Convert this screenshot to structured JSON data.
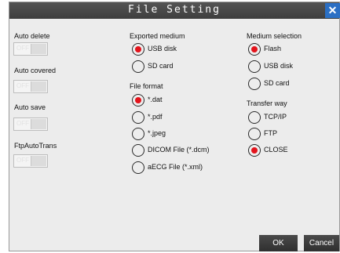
{
  "dialog": {
    "title": "File Setting",
    "close_label": "✕"
  },
  "left": {
    "items": [
      {
        "label": "Auto delete",
        "toggle": "OFF"
      },
      {
        "label": "Auto covered",
        "toggle": "OFF"
      },
      {
        "label": "Auto save",
        "toggle": "OFF"
      },
      {
        "label": "FtpAutoTrans",
        "toggle": "OFF"
      }
    ]
  },
  "exported_medium": {
    "label": "Exported medium",
    "options": [
      {
        "label": "USB disk",
        "selected": true
      },
      {
        "label": "SD card",
        "selected": false
      }
    ]
  },
  "file_format": {
    "label": "File format",
    "options": [
      {
        "label": "*.dat",
        "selected": true
      },
      {
        "label": "*.pdf",
        "selected": false
      },
      {
        "label": "*.jpeg",
        "selected": false
      },
      {
        "label": "DICOM File (*.dcm)",
        "selected": false
      },
      {
        "label": "aECG File (*.xml)",
        "selected": false
      }
    ]
  },
  "medium_selection": {
    "label": "Medium selection",
    "options": [
      {
        "label": "Flash",
        "selected": true
      },
      {
        "label": "USB disk",
        "selected": false
      },
      {
        "label": "SD card",
        "selected": false
      }
    ]
  },
  "transfer_way": {
    "label": "Transfer way",
    "options": [
      {
        "label": "TCP/IP",
        "selected": false
      },
      {
        "label": "FTP",
        "selected": false
      },
      {
        "label": "CLOSE",
        "selected": true
      }
    ]
  },
  "buttons": {
    "ok": "OK",
    "cancel": "Cancel"
  },
  "colors": {
    "title_bg": "#454545",
    "close_bg": "#2a6fc4",
    "radio_selected": "#e3141c",
    "dialog_bg": "#ececec"
  }
}
